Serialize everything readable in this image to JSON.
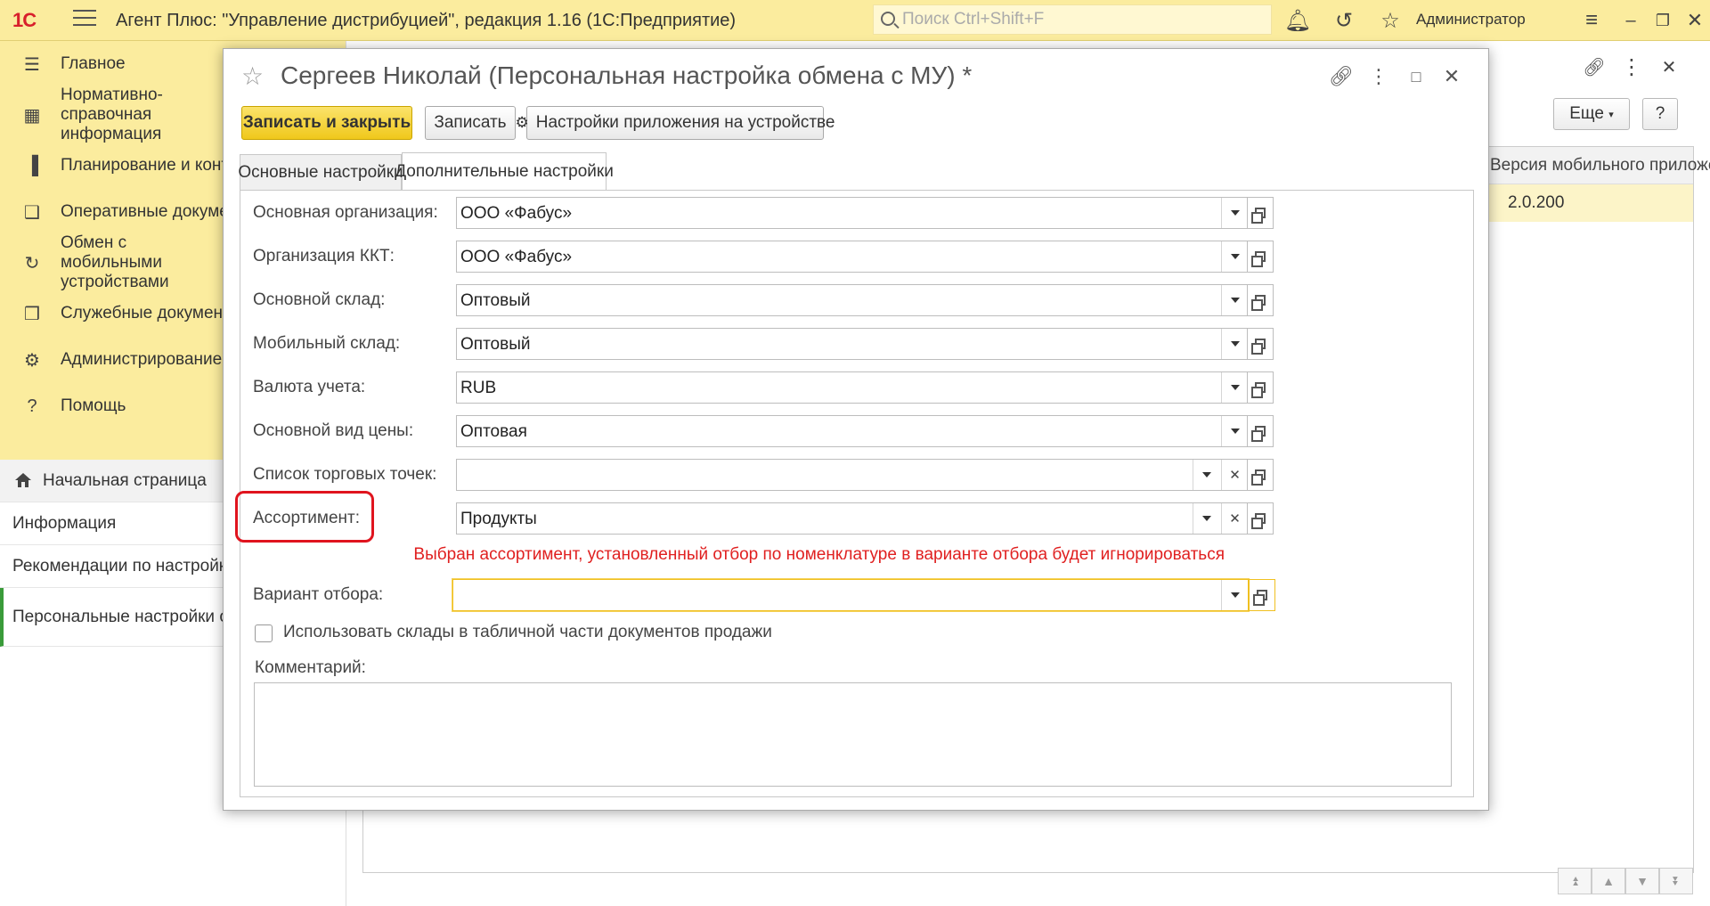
{
  "topbar": {
    "logo": "1С",
    "title": "Агент Плюс: \"Управление дистрибуцией\", редакция 1.16  (1С:Предприятие)",
    "search_placeholder": "Поиск Ctrl+Shift+F",
    "user": "Администратор",
    "icons": [
      "bell-icon",
      "history-icon",
      "star-icon",
      "settings-menu-icon",
      "minimize-icon",
      "restore-icon",
      "close-icon"
    ]
  },
  "sidebar": {
    "sections": [
      {
        "label": "Главное",
        "icon": "menu-icon"
      },
      {
        "label": "Нормативно-справочная информация",
        "icon": "directory-icon"
      },
      {
        "label": "Планирование и контроль",
        "icon": "chart-icon"
      },
      {
        "label": "Оперативные документы",
        "icon": "documents-icon"
      },
      {
        "label": "Обмен с мобильными устройствами",
        "icon": "sync-icon"
      },
      {
        "label": "Служебные документы",
        "icon": "service-docs-icon"
      },
      {
        "label": "Администрирование",
        "icon": "gear-icon"
      },
      {
        "label": "Помощь",
        "icon": "help-icon"
      }
    ],
    "nav": {
      "home": "Начальная страница",
      "info": "Информация",
      "recommendations": "Рекомендации по настройке",
      "personal": "Персональные настройки обмена с МУ"
    }
  },
  "background": {
    "more_label": "Еще",
    "help_label": "?",
    "column_header": "Версия мобильного приложения",
    "row_value": "2.0.200"
  },
  "form": {
    "title": "Сергеев Николай (Персональная настройка обмена с МУ) *",
    "buttons": {
      "save_close": "Записать и закрыть",
      "save": "Записать",
      "device_settings": "Настройки приложения на устройстве"
    },
    "tabs": {
      "main": "Основные настройки",
      "additional": "Дополнительные настройки"
    },
    "fields": {
      "main_org": {
        "label": "Основная организация:",
        "value": "ООО «Фабус»"
      },
      "kkt_org": {
        "label": "Организация ККТ:",
        "value": "ООО «Фабус»"
      },
      "main_store": {
        "label": "Основной склад:",
        "value": "Оптовый"
      },
      "mobile_store": {
        "label": "Мобильный склад:",
        "value": "Оптовый"
      },
      "currency": {
        "label": "Валюта учета:",
        "value": "RUB"
      },
      "price_type": {
        "label": "Основной вид цены:",
        "value": "Оптовая"
      },
      "outlets": {
        "label": "Список торговых точек:",
        "value": ""
      },
      "assortment": {
        "label": "Ассортимент:",
        "value": "Продукты"
      },
      "filter_variant": {
        "label": "Вариант отбора:",
        "value": ""
      }
    },
    "warning": "Выбран ассортимент, установленный отбор по номенклатуре в варианте отбора будет игнорироваться",
    "checkbox_label": "Использовать склады в табличной части документов продажи",
    "checkbox_checked": false,
    "comment_label": "Комментарий:",
    "comment_value": "",
    "highlight_color": "#e0141e",
    "accent_color": "#f0c81b"
  }
}
